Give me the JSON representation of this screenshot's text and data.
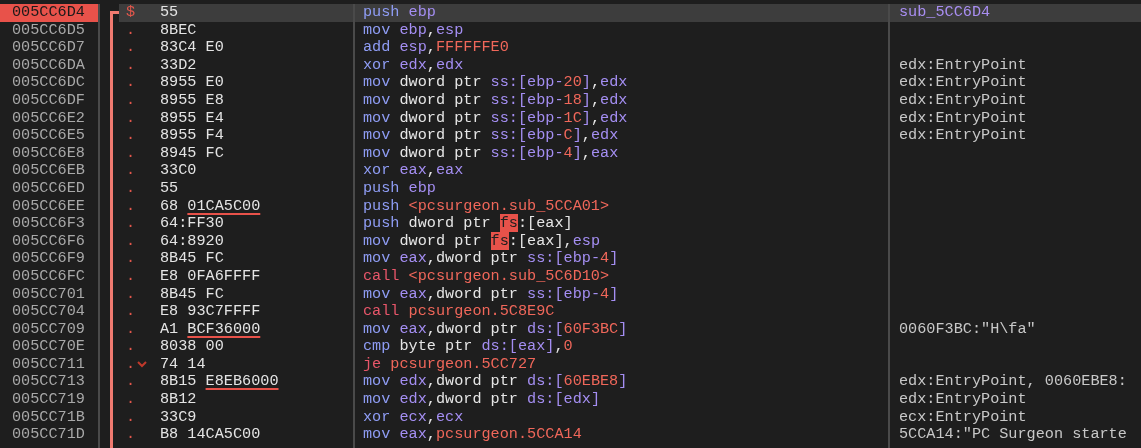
{
  "rows": [
    {
      "address": "005CC6D4",
      "selected": true,
      "marker": "$",
      "jump": false,
      "bytes": "55",
      "instruction": [
        {
          "text": "push ",
          "kind": "op"
        },
        {
          "text": "ebp",
          "kind": "reg"
        }
      ],
      "comment": {
        "text": "sub_5CC6D4",
        "kind": "label"
      }
    },
    {
      "address": "005CC6D5",
      "selected": false,
      "marker": ".",
      "jump": false,
      "bytes": "8BEC",
      "instruction": [
        {
          "text": "mov ",
          "kind": "op"
        },
        {
          "text": "ebp",
          "kind": "reg"
        },
        {
          "text": ",",
          "kind": "punct"
        },
        {
          "text": "esp",
          "kind": "reg"
        }
      ]
    },
    {
      "address": "005CC6D7",
      "selected": false,
      "marker": ".",
      "jump": false,
      "bytes": "83C4 E0",
      "instruction": [
        {
          "text": "add ",
          "kind": "op"
        },
        {
          "text": "esp",
          "kind": "reg"
        },
        {
          "text": ",",
          "kind": "punct"
        },
        {
          "text": "FFFFFFE0",
          "kind": "num"
        }
      ]
    },
    {
      "address": "005CC6DA",
      "selected": false,
      "marker": ".",
      "jump": false,
      "bytes": "33D2",
      "instruction": [
        {
          "text": "xor ",
          "kind": "op"
        },
        {
          "text": "edx",
          "kind": "reg"
        },
        {
          "text": ",",
          "kind": "punct"
        },
        {
          "text": "edx",
          "kind": "reg"
        }
      ],
      "comment": {
        "text": "edx:EntryPoint",
        "kind": "note"
      }
    },
    {
      "address": "005CC6DC",
      "selected": false,
      "marker": ".",
      "jump": false,
      "bytes": "8955 E0",
      "instruction": [
        {
          "text": "mov ",
          "kind": "op"
        },
        {
          "text": "dword ptr ",
          "kind": "kw"
        },
        {
          "text": "ss:[ebp-",
          "kind": "reg"
        },
        {
          "text": "20",
          "kind": "num"
        },
        {
          "text": "]",
          "kind": "reg"
        },
        {
          "text": ",",
          "kind": "punct"
        },
        {
          "text": "edx",
          "kind": "reg"
        }
      ],
      "comment": {
        "text": "edx:EntryPoint",
        "kind": "note"
      }
    },
    {
      "address": "005CC6DF",
      "selected": false,
      "marker": ".",
      "jump": false,
      "bytes": "8955 E8",
      "instruction": [
        {
          "text": "mov ",
          "kind": "op"
        },
        {
          "text": "dword ptr ",
          "kind": "kw"
        },
        {
          "text": "ss:[ebp-",
          "kind": "reg"
        },
        {
          "text": "18",
          "kind": "num"
        },
        {
          "text": "]",
          "kind": "reg"
        },
        {
          "text": ",",
          "kind": "punct"
        },
        {
          "text": "edx",
          "kind": "reg"
        }
      ],
      "comment": {
        "text": "edx:EntryPoint",
        "kind": "note"
      }
    },
    {
      "address": "005CC6E2",
      "selected": false,
      "marker": ".",
      "jump": false,
      "bytes": "8955 E4",
      "instruction": [
        {
          "text": "mov ",
          "kind": "op"
        },
        {
          "text": "dword ptr ",
          "kind": "kw"
        },
        {
          "text": "ss:[ebp-",
          "kind": "reg"
        },
        {
          "text": "1C",
          "kind": "num"
        },
        {
          "text": "]",
          "kind": "reg"
        },
        {
          "text": ",",
          "kind": "punct"
        },
        {
          "text": "edx",
          "kind": "reg"
        }
      ],
      "comment": {
        "text": "edx:EntryPoint",
        "kind": "note"
      }
    },
    {
      "address": "005CC6E5",
      "selected": false,
      "marker": ".",
      "jump": false,
      "bytes": "8955 F4",
      "instruction": [
        {
          "text": "mov ",
          "kind": "op"
        },
        {
          "text": "dword ptr ",
          "kind": "kw"
        },
        {
          "text": "ss:[ebp-",
          "kind": "reg"
        },
        {
          "text": "C",
          "kind": "num"
        },
        {
          "text": "]",
          "kind": "reg"
        },
        {
          "text": ",",
          "kind": "punct"
        },
        {
          "text": "edx",
          "kind": "reg"
        }
      ],
      "comment": {
        "text": "edx:EntryPoint",
        "kind": "note"
      }
    },
    {
      "address": "005CC6E8",
      "selected": false,
      "marker": ".",
      "jump": false,
      "bytes": "8945 FC",
      "instruction": [
        {
          "text": "mov ",
          "kind": "op"
        },
        {
          "text": "dword ptr ",
          "kind": "kw"
        },
        {
          "text": "ss:[ebp-",
          "kind": "reg"
        },
        {
          "text": "4",
          "kind": "num"
        },
        {
          "text": "]",
          "kind": "reg"
        },
        {
          "text": ",",
          "kind": "punct"
        },
        {
          "text": "eax",
          "kind": "reg"
        }
      ]
    },
    {
      "address": "005CC6EB",
      "selected": false,
      "marker": ".",
      "jump": false,
      "bytes": "33C0",
      "instruction": [
        {
          "text": "xor ",
          "kind": "op"
        },
        {
          "text": "eax",
          "kind": "reg"
        },
        {
          "text": ",",
          "kind": "punct"
        },
        {
          "text": "eax",
          "kind": "reg"
        }
      ]
    },
    {
      "address": "005CC6ED",
      "selected": false,
      "marker": ".",
      "jump": false,
      "bytes": "55",
      "instruction": [
        {
          "text": "push ",
          "kind": "op"
        },
        {
          "text": "ebp",
          "kind": "reg"
        }
      ]
    },
    {
      "address": "005CC6EE",
      "selected": false,
      "marker": ".",
      "jump": false,
      "bytes": "68",
      "bytes_ref": "01CA5C00",
      "instruction": [
        {
          "text": "push ",
          "kind": "op"
        },
        {
          "text": "<pcsurgeon.sub_5CCA01>",
          "kind": "label"
        }
      ]
    },
    {
      "address": "005CC6F3",
      "selected": false,
      "marker": ".",
      "jump": false,
      "bytes": "64:FF30",
      "instruction": [
        {
          "text": "push ",
          "kind": "op"
        },
        {
          "text": "dword ptr ",
          "kind": "kw"
        },
        {
          "text": "fs",
          "kind": "hl"
        },
        {
          "text": ":[eax]",
          "kind": "punct"
        }
      ]
    },
    {
      "address": "005CC6F6",
      "selected": false,
      "marker": ".",
      "jump": false,
      "bytes": "64:8920",
      "instruction": [
        {
          "text": "mov ",
          "kind": "op"
        },
        {
          "text": "dword ptr ",
          "kind": "kw"
        },
        {
          "text": "fs",
          "kind": "hl"
        },
        {
          "text": ":[eax],",
          "kind": "punct"
        },
        {
          "text": "esp",
          "kind": "reg"
        }
      ]
    },
    {
      "address": "005CC6F9",
      "selected": false,
      "marker": ".",
      "jump": false,
      "bytes": "8B45 FC",
      "instruction": [
        {
          "text": "mov ",
          "kind": "op"
        },
        {
          "text": "eax",
          "kind": "reg"
        },
        {
          "text": ",",
          "kind": "punct"
        },
        {
          "text": "dword ptr ",
          "kind": "kw"
        },
        {
          "text": "ss:[ebp-",
          "kind": "reg"
        },
        {
          "text": "4",
          "kind": "num"
        },
        {
          "text": "]",
          "kind": "reg"
        }
      ]
    },
    {
      "address": "005CC6FC",
      "selected": false,
      "marker": ".",
      "jump": false,
      "bytes": "E8 0FA6FFFF",
      "instruction": [
        {
          "text": "call ",
          "kind": "branch"
        },
        {
          "text": "<pcsurgeon.sub_5C6D10>",
          "kind": "label"
        }
      ]
    },
    {
      "address": "005CC701",
      "selected": false,
      "marker": ".",
      "jump": false,
      "bytes": "8B45 FC",
      "instruction": [
        {
          "text": "mov ",
          "kind": "op"
        },
        {
          "text": "eax",
          "kind": "reg"
        },
        {
          "text": ",",
          "kind": "punct"
        },
        {
          "text": "dword ptr ",
          "kind": "kw"
        },
        {
          "text": "ss:[ebp-",
          "kind": "reg"
        },
        {
          "text": "4",
          "kind": "num"
        },
        {
          "text": "]",
          "kind": "reg"
        }
      ]
    },
    {
      "address": "005CC704",
      "selected": false,
      "marker": ".",
      "jump": false,
      "bytes": "E8 93C7FFFF",
      "instruction": [
        {
          "text": "call ",
          "kind": "branch"
        },
        {
          "text": "pcsurgeon.5C8E9C",
          "kind": "label"
        }
      ]
    },
    {
      "address": "005CC709",
      "selected": false,
      "marker": ".",
      "jump": false,
      "bytes": "A1",
      "bytes_ref": "BCF36000",
      "instruction": [
        {
          "text": "mov ",
          "kind": "op"
        },
        {
          "text": "eax",
          "kind": "reg"
        },
        {
          "text": ",",
          "kind": "punct"
        },
        {
          "text": "dword ptr ",
          "kind": "kw"
        },
        {
          "text": "ds:[",
          "kind": "reg"
        },
        {
          "text": "60F3BC",
          "kind": "num"
        },
        {
          "text": "]",
          "kind": "reg"
        }
      ],
      "comment": {
        "text": "0060F3BC:\"H\\fa\"",
        "kind": "note"
      }
    },
    {
      "address": "005CC70E",
      "selected": false,
      "marker": ".",
      "jump": false,
      "bytes": "8038 00",
      "instruction": [
        {
          "text": "cmp ",
          "kind": "op"
        },
        {
          "text": "byte ptr ",
          "kind": "kw"
        },
        {
          "text": "ds:[eax]",
          "kind": "reg"
        },
        {
          "text": ",",
          "kind": "punct"
        },
        {
          "text": "0",
          "kind": "num"
        }
      ]
    },
    {
      "address": "005CC711",
      "selected": false,
      "marker": ".",
      "jump": true,
      "bytes": "74 14",
      "instruction": [
        {
          "text": "je ",
          "kind": "branch"
        },
        {
          "text": "pcsurgeon.5CC727",
          "kind": "label"
        }
      ]
    },
    {
      "address": "005CC713",
      "selected": false,
      "marker": ".",
      "jump": false,
      "bytes": "8B15",
      "bytes_ref": "E8EB6000",
      "instruction": [
        {
          "text": "mov ",
          "kind": "op"
        },
        {
          "text": "edx",
          "kind": "reg"
        },
        {
          "text": ",",
          "kind": "punct"
        },
        {
          "text": "dword ptr ",
          "kind": "kw"
        },
        {
          "text": "ds:[",
          "kind": "reg"
        },
        {
          "text": "60EBE8",
          "kind": "num"
        },
        {
          "text": "]",
          "kind": "reg"
        }
      ],
      "comment": {
        "text": "edx:EntryPoint, 0060EBE8:",
        "kind": "note"
      }
    },
    {
      "address": "005CC719",
      "selected": false,
      "marker": ".",
      "jump": false,
      "bytes": "8B12",
      "instruction": [
        {
          "text": "mov ",
          "kind": "op"
        },
        {
          "text": "edx",
          "kind": "reg"
        },
        {
          "text": ",",
          "kind": "punct"
        },
        {
          "text": "dword ptr ",
          "kind": "kw"
        },
        {
          "text": "ds:[edx]",
          "kind": "reg"
        }
      ],
      "comment": {
        "text": "edx:EntryPoint",
        "kind": "note"
      }
    },
    {
      "address": "005CC71B",
      "selected": false,
      "marker": ".",
      "jump": false,
      "bytes": "33C9",
      "instruction": [
        {
          "text": "xor ",
          "kind": "op"
        },
        {
          "text": "ecx",
          "kind": "reg"
        },
        {
          "text": ",",
          "kind": "punct"
        },
        {
          "text": "ecx",
          "kind": "reg"
        }
      ],
      "comment": {
        "text": "ecx:EntryPoint",
        "kind": "note"
      }
    },
    {
      "address": "005CC71D",
      "selected": false,
      "marker": ".",
      "jump": false,
      "bytes": "B8 14CA5C00",
      "instruction": [
        {
          "text": "mov ",
          "kind": "op"
        },
        {
          "text": "eax",
          "kind": "reg"
        },
        {
          "text": ",",
          "kind": "punct"
        },
        {
          "text": "pcsurgeon.5CCA14",
          "kind": "label"
        }
      ],
      "comment": {
        "text": "5CCA14:\"PC Surgeon starte",
        "kind": "note"
      }
    }
  ]
}
